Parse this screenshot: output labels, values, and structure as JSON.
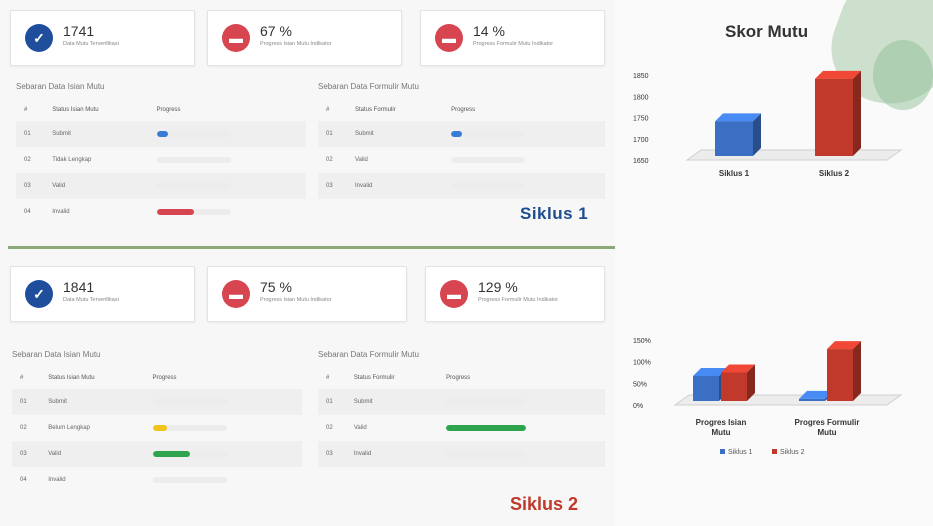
{
  "siklus1": {
    "label": "Siklus 1",
    "cards": [
      {
        "value": "1741",
        "desc": "Data Mutu Terverifikasi"
      },
      {
        "value": "67 %",
        "desc": "Progress Isian Mutu Indikator"
      },
      {
        "value": "14 %",
        "desc": "Progress Formulir Mutu Indikator"
      }
    ],
    "table_left": {
      "title": "Sebaran Data Isian Mutu",
      "headers": [
        "#",
        "Status Isian Mutu",
        "Progress"
      ],
      "rows": [
        {
          "no": "01",
          "status": "Submit",
          "progress": 0.15,
          "color": "#3a7bd5"
        },
        {
          "no": "02",
          "status": "Tidak Lengkap",
          "progress": 0,
          "color": "#f0b429"
        },
        {
          "no": "03",
          "status": "Valid",
          "progress": 0,
          "color": "#2ea44f"
        },
        {
          "no": "04",
          "status": "Invalid",
          "progress": 0.5,
          "color": "#d64550"
        }
      ]
    },
    "table_right": {
      "title": "Sebaran Data Formulir Mutu",
      "headers": [
        "#",
        "Status Formulir",
        "Progress"
      ],
      "rows": [
        {
          "no": "01",
          "status": "Submit",
          "progress": 0.15,
          "color": "#3a7bd5"
        },
        {
          "no": "02",
          "status": "Valid",
          "progress": 0,
          "color": "#2ea44f"
        },
        {
          "no": "03",
          "status": "Invalid",
          "progress": 0,
          "color": "#d64550"
        }
      ]
    }
  },
  "siklus2": {
    "label": "Siklus 2",
    "cards": [
      {
        "value": "1841",
        "desc": "Data Mutu Terverifikasi"
      },
      {
        "value": "75 %",
        "desc": "Progress Isian Mutu Indikator"
      },
      {
        "value": "129 %",
        "desc": "Progress Formulir Mutu Indikator"
      }
    ],
    "table_left": {
      "title": "Sebaran Data Isian Mutu",
      "headers": [
        "#",
        "Status Isian Mutu",
        "Progress"
      ],
      "rows": [
        {
          "no": "01",
          "status": "Submit",
          "progress": 0,
          "color": "#3a7bd5"
        },
        {
          "no": "02",
          "status": "Belum Lengkap",
          "progress": 0.2,
          "color": "#f0c419"
        },
        {
          "no": "03",
          "status": "Valid",
          "progress": 0.5,
          "color": "#2ea44f"
        },
        {
          "no": "04",
          "status": "Invalid",
          "progress": 0,
          "color": "#d64550"
        }
      ]
    },
    "table_right": {
      "title": "Sebaran Data Formulir Mutu",
      "headers": [
        "#",
        "Status Formulir",
        "Progress"
      ],
      "rows": [
        {
          "no": "01",
          "status": "Submit",
          "progress": 0,
          "color": "#3a7bd5"
        },
        {
          "no": "02",
          "status": "Valid",
          "progress": 1.0,
          "color": "#2ea44f"
        },
        {
          "no": "03",
          "status": "Invalid",
          "progress": 0,
          "color": "#d64550"
        }
      ]
    }
  },
  "colors": {
    "blue_icon": "#1f4e9c",
    "red_icon": "#d64550",
    "series1": "#3a6fc4",
    "series2": "#c0392b"
  },
  "icons": {
    "card1": "check-circle-icon",
    "card2": "folder-icon",
    "card3": "folder-icon"
  },
  "chart_data": [
    {
      "type": "bar",
      "title": "Skor Mutu",
      "categories": [
        "Siklus 1",
        "Siklus 2"
      ],
      "values": [
        1741,
        1841
      ],
      "ylim": [
        1650,
        1850
      ],
      "yticks": [
        "1650",
        "1700",
        "1750",
        "1800",
        "1850"
      ],
      "colors": [
        "#3a6fc4",
        "#c0392b"
      ]
    },
    {
      "type": "bar",
      "title": "",
      "categories": [
        "Progres Isian Mutu",
        "Progres Formulir Mutu"
      ],
      "series": [
        {
          "name": "Siklus 1",
          "values": [
            67,
            14
          ],
          "color": "#3a6fc4"
        },
        {
          "name": "Siklus 2",
          "values": [
            75,
            129
          ],
          "color": "#c0392b"
        }
      ],
      "ylim": [
        0,
        150
      ],
      "yticks": [
        "0%",
        "50%",
        "100%",
        "150%"
      ],
      "legend": "bottom"
    }
  ]
}
